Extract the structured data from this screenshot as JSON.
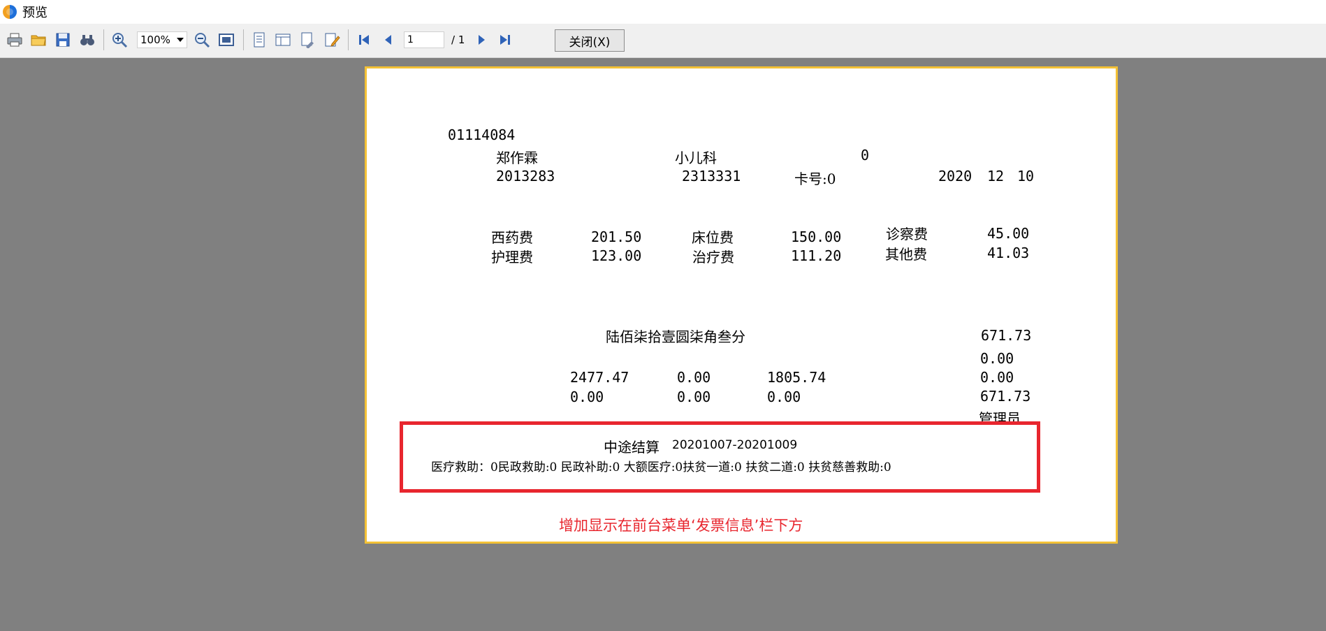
{
  "window": {
    "title": "预览"
  },
  "toolbar": {
    "zoom_value": "100%",
    "page_value": "1",
    "page_total": "/ 1",
    "close_label": "关闭(X)"
  },
  "invoice": {
    "invoice_no": "01114084",
    "patient_name": "郑作霖",
    "department": "小儿科",
    "field_zero": "0",
    "hospital_no": "2013283",
    "settle_no": "2313331",
    "card_no": "卡号:0",
    "year": "2020",
    "month": "12",
    "day": "10",
    "fees": [
      {
        "label": "西药费",
        "value": "201.50"
      },
      {
        "label": "床位费",
        "value": "150.00"
      },
      {
        "label": "诊察费",
        "value": "45.00"
      },
      {
        "label": "护理费",
        "value": "123.00"
      },
      {
        "label": "治疗费",
        "value": "111.20"
      },
      {
        "label": "其他费",
        "value": "41.03"
      }
    ],
    "amount_words": "陆佰柒拾壹圆柒角叁分",
    "amount_total": "671.73",
    "right_col": [
      "0.00",
      "0.00",
      "671.73"
    ],
    "row1": [
      "2477.47",
      "0.00",
      "1805.74"
    ],
    "row2": [
      "0.00",
      "0.00",
      "0.00"
    ],
    "operator": "管理员",
    "midway_label": "中途结算",
    "midway_dates": "20201007-20201009",
    "aid_line": "医疗救助：0民政救助:0 民政补助:0 大额医疗:0扶贫一道:0 扶贫二道:0 扶贫慈善救助:0"
  },
  "annotation": {
    "note": "增加显示在前台菜单‘发票信息’栏下方",
    "color": "#e8262e"
  },
  "colors": {
    "paper_border": "#f3c136",
    "background": "#808080"
  }
}
